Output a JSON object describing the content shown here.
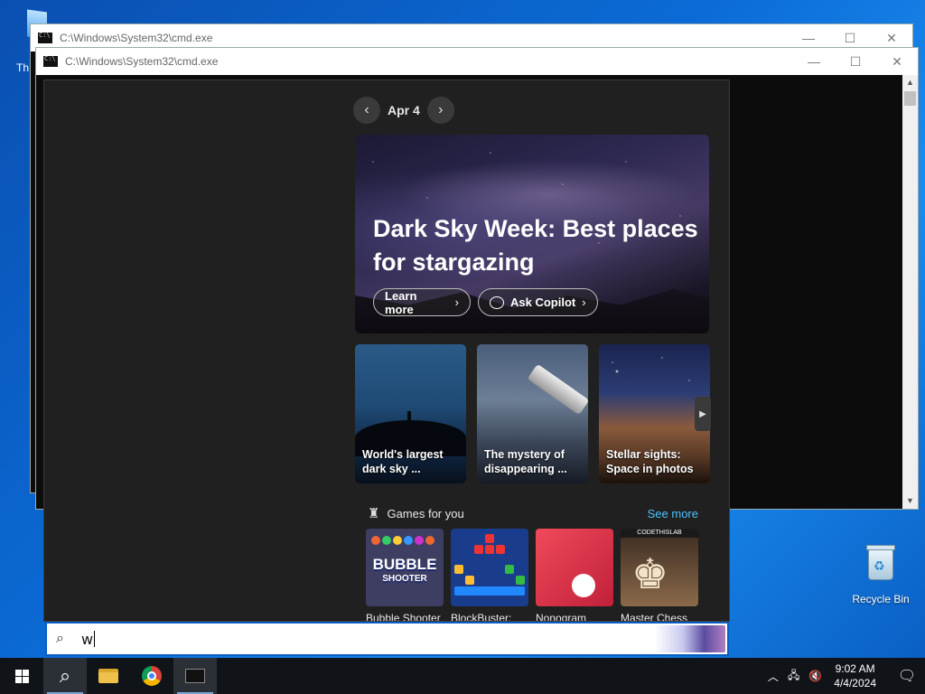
{
  "desktop": {
    "partial_icon_label": "Th",
    "recycle_bin_label": "Recycle Bin"
  },
  "windows": [
    {
      "title": "C:\\Windows\\System32\\cmd.exe"
    },
    {
      "title": "C:\\Windows\\System32\\cmd.exe"
    }
  ],
  "window_controls": {
    "minimize": "—",
    "maximize": "☐",
    "close": "✕"
  },
  "search_panel": {
    "date": "Apr 4",
    "prev_icon": "chevron-left-icon",
    "next_icon": "chevron-right-icon",
    "hero": {
      "headline": "Dark Sky Week: Best places for stargazing",
      "learn_more": "Learn more",
      "ask_copilot": "Ask Copilot"
    },
    "cards": [
      {
        "caption": "World's largest dark sky ..."
      },
      {
        "caption": "The mystery of disappearing ..."
      },
      {
        "caption": "Stellar sights: Space in photos"
      }
    ],
    "games": {
      "title": "Games for you",
      "see_more": "See more",
      "items": [
        {
          "name": "Bubble Shooter",
          "thumb_text": "BUBBLE",
          "thumb_sub": "SHOOTER"
        },
        {
          "name": "BlockBuster:"
        },
        {
          "name": "Nonogram"
        },
        {
          "name": "Master Chess",
          "thumb_band": "CODETHISLAB"
        }
      ]
    }
  },
  "search_box": {
    "value": "w"
  },
  "taskbar": {
    "items": [
      "start",
      "search",
      "file-explorer",
      "chrome",
      "cmd"
    ],
    "clock_time": "9:02 AM",
    "clock_date": "4/4/2024"
  }
}
